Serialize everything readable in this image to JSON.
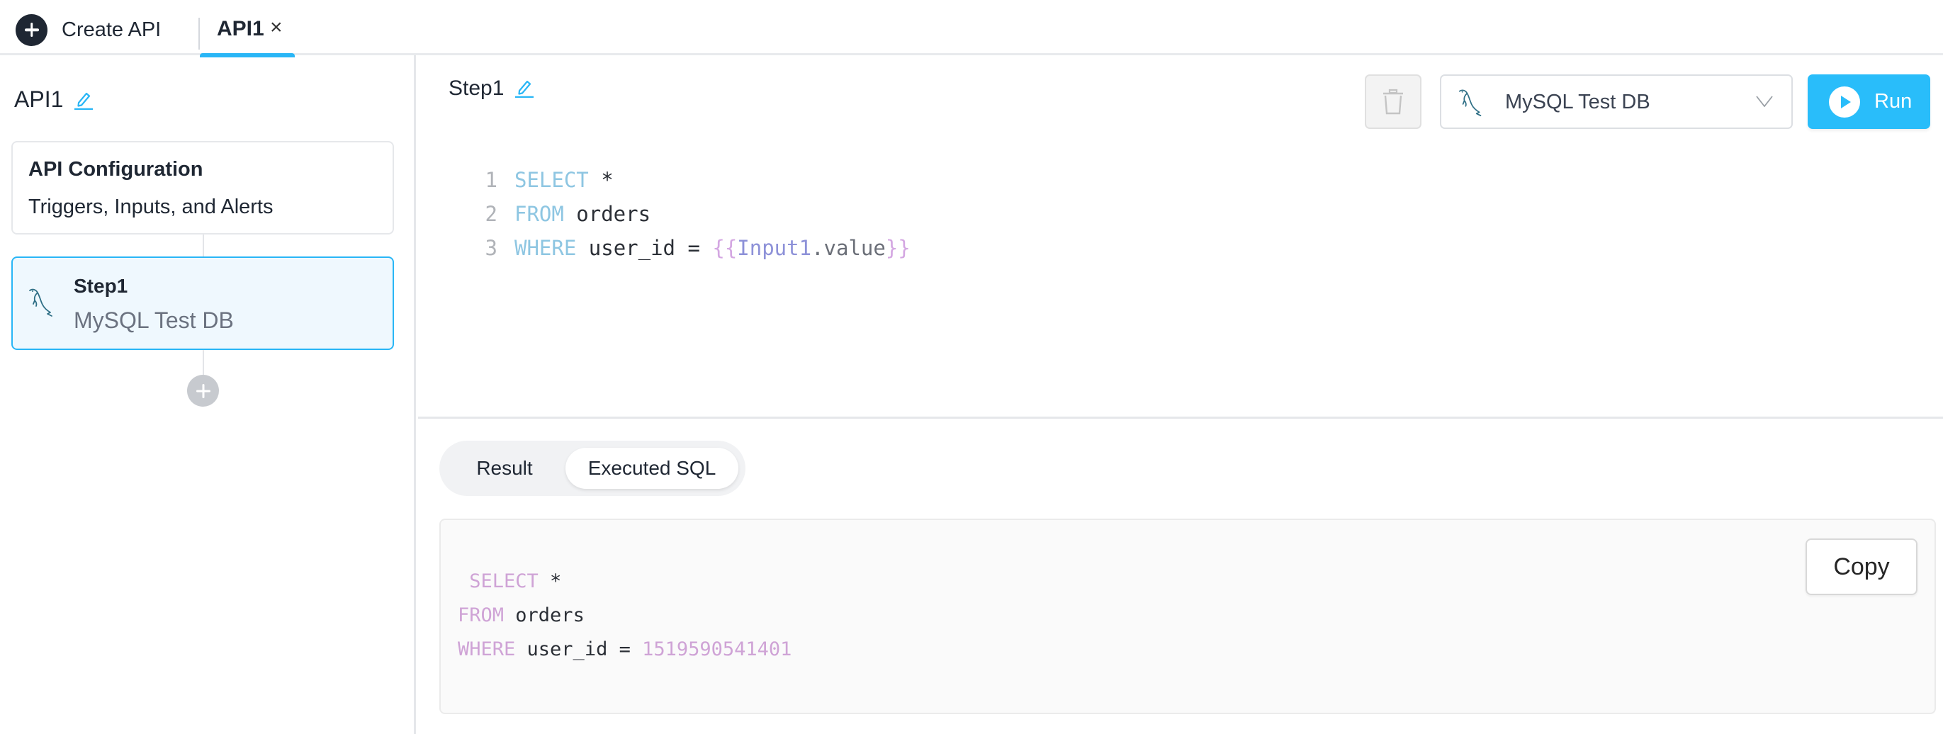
{
  "topbar": {
    "create_label": "Create API",
    "tabs": [
      {
        "label": "API1",
        "active": true,
        "close_glyph": "×"
      }
    ]
  },
  "sidebar": {
    "api_name": "API1",
    "config_card": {
      "title": "API Configuration",
      "subtitle": "Triggers, Inputs, and Alerts"
    },
    "steps": [
      {
        "title": "Step1",
        "datasource": "MySQL Test DB",
        "icon": "mysql-dolphin-icon",
        "selected": true
      }
    ]
  },
  "main": {
    "step_title": "Step1",
    "datasource_select": {
      "value": "MySQL Test DB"
    },
    "run_label": "Run",
    "editor": {
      "lines": [
        {
          "num": "1",
          "tokens": [
            {
              "t": "SELECT",
              "c": "kw"
            },
            {
              "t": " *",
              "c": "plain"
            }
          ]
        },
        {
          "num": "2",
          "tokens": [
            {
              "t": "FROM",
              "c": "kw"
            },
            {
              "t": " orders",
              "c": "plain"
            }
          ]
        },
        {
          "num": "3",
          "tokens": [
            {
              "t": "WHERE",
              "c": "kw"
            },
            {
              "t": " user_id = ",
              "c": "plain"
            },
            {
              "t": "{{",
              "c": "brace"
            },
            {
              "t": "Input1",
              "c": "var"
            },
            {
              "t": ".value",
              "c": "prop"
            },
            {
              "t": "}}",
              "c": "brace"
            }
          ]
        }
      ]
    },
    "result_tabs": [
      {
        "label": "Result",
        "active": false
      },
      {
        "label": "Executed SQL",
        "active": true
      }
    ],
    "executed_sql": {
      "copy_label": "Copy",
      "lines": [
        {
          "tokens": [
            {
              "t": " SELECT",
              "c": "pk"
            },
            {
              "t": " *",
              "c": "plain"
            }
          ]
        },
        {
          "tokens": [
            {
              "t": "FROM",
              "c": "pk"
            },
            {
              "t": " orders",
              "c": "plain"
            }
          ]
        },
        {
          "tokens": [
            {
              "t": "WHERE",
              "c": "pk"
            },
            {
              "t": " user_id = ",
              "c": "plain"
            },
            {
              "t": "1519590541401",
              "c": "pnum"
            }
          ]
        }
      ]
    }
  },
  "colors": {
    "accent": "#29b6f6",
    "run_button": "#29bdfa",
    "selected_step_bg": "#eff8fe",
    "dark_text": "#1f2733",
    "sql_keyword": "#8ec6e2",
    "executed_keyword": "#cfa3d6"
  }
}
